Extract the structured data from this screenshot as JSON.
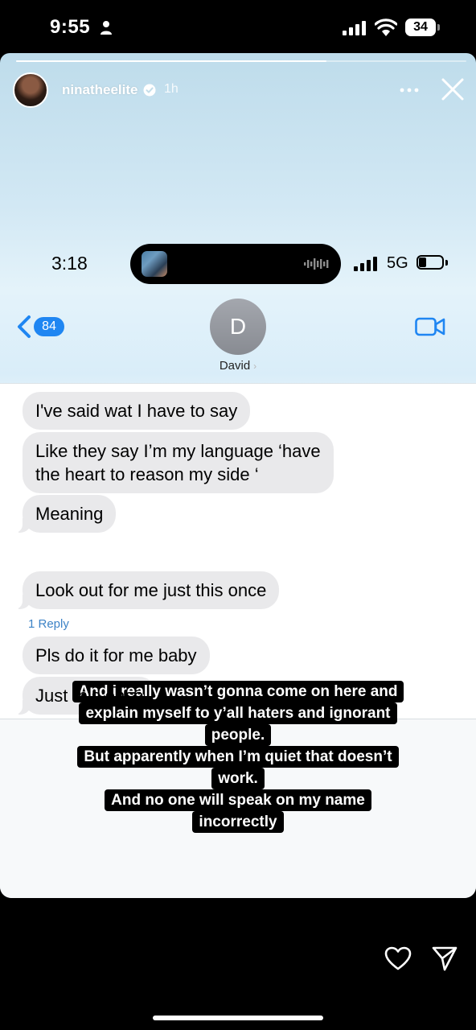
{
  "phone_status": {
    "time": "9:55",
    "battery": "34"
  },
  "story": {
    "username": "ninatheelite",
    "time_ago": "1h",
    "progress": 0.69
  },
  "inner_screenshot": {
    "status": {
      "time": "3:18",
      "network": "5G"
    },
    "header": {
      "back_count": "84",
      "contact_initial": "D",
      "contact_name": "David"
    },
    "messages": [
      {
        "text": "I've said wat I have to say"
      },
      {
        "text": "Like they say I’m my language ‘have",
        "text2": "the heart to reason my side ‘"
      },
      {
        "text": "Meaning"
      },
      {
        "text": "Look out for me just this once"
      },
      {
        "text": "Pls do it for me baby"
      },
      {
        "text": "Just this once"
      }
    ],
    "reply_link": "1 Reply"
  },
  "caption_lines": [
    "And i really wasn’t gonna come on here and",
    "explain myself to y’all haters and ignorant",
    "people.",
    "But apparently when I’m quiet that doesn’t",
    "work.",
    "And no one will speak on my name",
    "incorrectly"
  ],
  "colors": {
    "imessage_blue": "#1f86f2",
    "bubble_gray": "#e9e9eb",
    "reply_blue": "#3d83c6"
  }
}
